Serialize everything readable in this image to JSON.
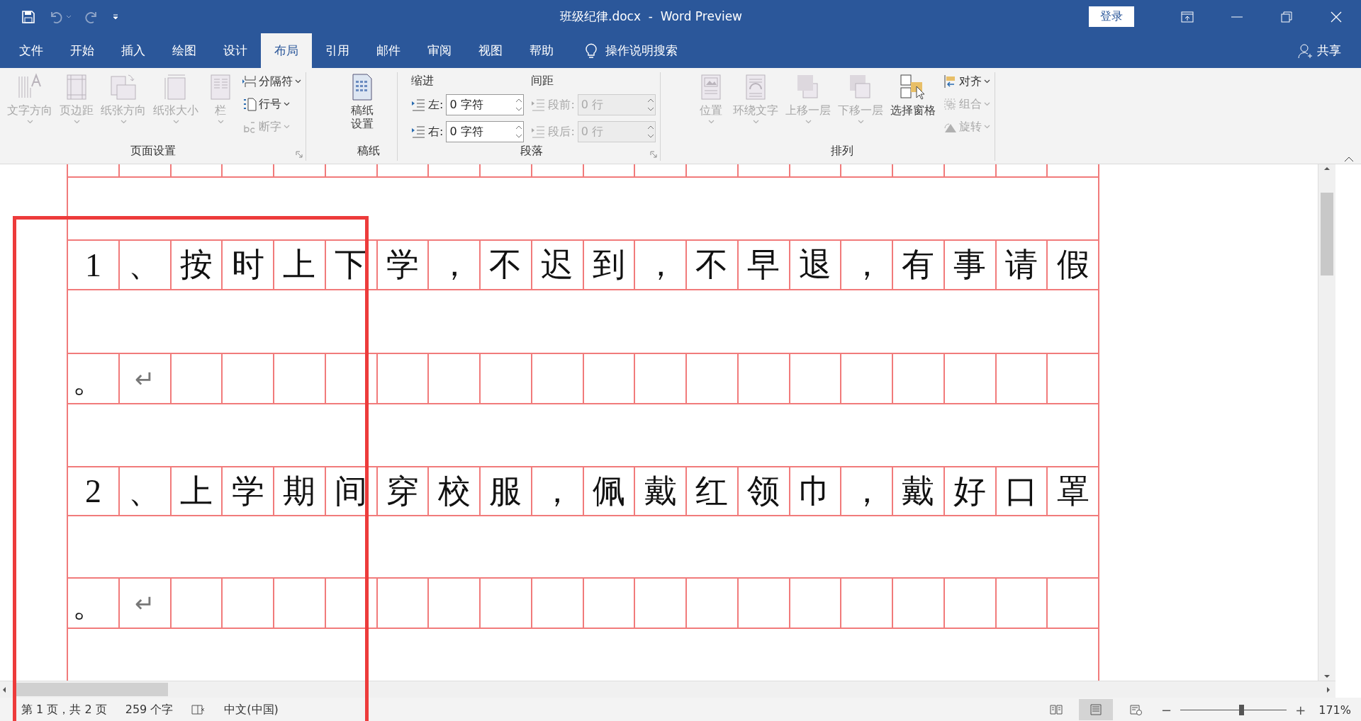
{
  "title_bar": {
    "title": "班级纪律.docx  -  Word Preview",
    "sign_in": "登录"
  },
  "tabs": [
    {
      "label": "文件",
      "selected": false
    },
    {
      "label": "开始",
      "selected": false
    },
    {
      "label": "插入",
      "selected": false
    },
    {
      "label": "绘图",
      "selected": false
    },
    {
      "label": "设计",
      "selected": false
    },
    {
      "label": "布局",
      "selected": true
    },
    {
      "label": "引用",
      "selected": false
    },
    {
      "label": "邮件",
      "selected": false
    },
    {
      "label": "审阅",
      "selected": false
    },
    {
      "label": "视图",
      "selected": false
    },
    {
      "label": "帮助",
      "selected": false
    }
  ],
  "tell_me": "操作说明搜索",
  "share": "共享",
  "ribbon": {
    "groups": [
      {
        "label": "页面设置",
        "launcher": true,
        "items": [
          {
            "kind": "large",
            "label": "文字方向",
            "disabled": true,
            "dropdown": true
          },
          {
            "kind": "large",
            "label": "页边距",
            "disabled": true,
            "dropdown": true
          },
          {
            "kind": "large",
            "label": "纸张方向",
            "disabled": true,
            "dropdown": true
          },
          {
            "kind": "large",
            "label": "纸张大小",
            "disabled": true,
            "dropdown": true
          },
          {
            "kind": "large",
            "label": "栏",
            "disabled": true,
            "dropdown": true
          },
          {
            "kind": "stack",
            "items": [
              {
                "label": "分隔符",
                "disabled": false,
                "dropdown": true
              },
              {
                "label": "行号",
                "disabled": false,
                "dropdown": true
              },
              {
                "label": "断字",
                "disabled": true,
                "dropdown": true
              }
            ]
          }
        ]
      },
      {
        "label": "稿纸",
        "launcher": false,
        "items": [
          {
            "kind": "large",
            "label": "稿纸设置",
            "disabled": false,
            "dropdown": false
          }
        ]
      },
      {
        "label": "段落",
        "launcher": true,
        "items": [
          {
            "kind": "paragraph",
            "headers": [
              "缩进",
              "间距"
            ],
            "fields": [
              {
                "label": "左:",
                "value": "0 字符",
                "disabled": false
              },
              {
                "label": "段前:",
                "value": "0 行",
                "disabled": true
              },
              {
                "label": "右:",
                "value": "0 字符",
                "disabled": false
              },
              {
                "label": "段后:",
                "value": "0 行",
                "disabled": true
              }
            ]
          }
        ]
      },
      {
        "label": "排列",
        "launcher": false,
        "items": [
          {
            "kind": "large",
            "label": "位置",
            "disabled": true,
            "dropdown": true
          },
          {
            "kind": "large",
            "label": "环绕文字",
            "disabled": true,
            "dropdown": true
          },
          {
            "kind": "large",
            "label": "上移一层",
            "disabled": true,
            "dropdown": true
          },
          {
            "kind": "large",
            "label": "下移一层",
            "disabled": true,
            "dropdown": true
          },
          {
            "kind": "large",
            "label": "选择窗格",
            "disabled": false,
            "dropdown": false
          },
          {
            "kind": "stack",
            "items": [
              {
                "label": "对齐",
                "disabled": false,
                "dropdown": true
              },
              {
                "label": "组合",
                "disabled": true,
                "dropdown": true
              },
              {
                "label": "旋转",
                "disabled": true,
                "dropdown": true
              }
            ]
          }
        ]
      }
    ]
  },
  "document": {
    "rows": [
      {
        "cells": []
      },
      {
        "cells": [
          "1",
          "、",
          "按",
          "时",
          "上",
          "下",
          "学",
          "，",
          "不",
          "迟",
          "到",
          "，",
          "不",
          "早",
          "退",
          "，",
          "有",
          "事",
          "请",
          "假"
        ]
      },
      {
        "cells": [
          "。"
        ],
        "end_mark": "↵"
      },
      {
        "cells": [
          "2",
          "、",
          "上",
          "学",
          "期",
          "间",
          "穿",
          "校",
          "服",
          "，",
          "佩",
          "戴",
          "红",
          "领",
          "巾",
          "，",
          "戴",
          "好",
          "口",
          "罩"
        ]
      },
      {
        "cells": [
          "。"
        ],
        "end_mark": "↵"
      }
    ]
  },
  "status_bar": {
    "page": "第 1 页，共 2 页",
    "words": "259 个字",
    "language": "中文(中国)",
    "views": [
      {
        "selected": false
      },
      {
        "selected": true
      },
      {
        "selected": false
      }
    ],
    "zoom": {
      "minus": "−",
      "plus": "+",
      "level": 0.57,
      "reading": "171%"
    }
  }
}
